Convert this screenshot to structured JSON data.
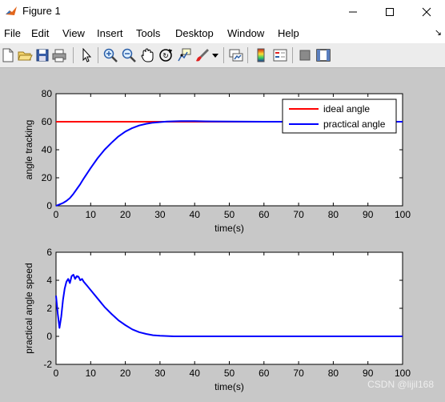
{
  "window": {
    "title": "Figure 1",
    "minimize_icon": "minimize-icon",
    "maximize_icon": "maximize-icon",
    "close_icon": "close-icon"
  },
  "menu": {
    "items": [
      "File",
      "Edit",
      "View",
      "Insert",
      "Tools",
      "Desktop",
      "Window",
      "Help"
    ],
    "overflow_arrow": "↘"
  },
  "toolbar": {
    "icons": [
      "new-figure-icon",
      "open-file-icon",
      "save-icon",
      "print-icon",
      "pointer-icon",
      "zoom-in-icon",
      "zoom-out-icon",
      "pan-icon",
      "rotate-3d-icon",
      "data-cursor-icon",
      "brush-icon",
      "link-plot-icon",
      "colorbar-icon",
      "legend-icon",
      "hide-plot-tools-icon",
      "show-plot-tools-icon"
    ]
  },
  "watermark": "CSDN @lijil168",
  "chart_data": [
    {
      "type": "line",
      "xlabel": "time(s)",
      "ylabel": "angle tracking",
      "xlim": [
        0,
        100
      ],
      "ylim": [
        0,
        80
      ],
      "xticks": [
        "0",
        "10",
        "20",
        "30",
        "40",
        "50",
        "60",
        "70",
        "80",
        "90",
        "100"
      ],
      "yticks": [
        "0",
        "20",
        "40",
        "60",
        "80"
      ],
      "legend": {
        "placement": "top-right"
      },
      "series": [
        {
          "name": "ideal angle",
          "color": "#ff0000",
          "x": [
            0,
            100
          ],
          "y": [
            60,
            60
          ]
        },
        {
          "name": "practical angle",
          "color": "#0000ff",
          "x": [
            0,
            1,
            2,
            3,
            4,
            5,
            6,
            7,
            8,
            10,
            12,
            14,
            16,
            18,
            20,
            22,
            24,
            26,
            28,
            30,
            32,
            34,
            36,
            38,
            40,
            45,
            50,
            60,
            70,
            80,
            90,
            100
          ],
          "y": [
            0,
            1,
            2,
            3.5,
            5.5,
            8.5,
            12,
            15.5,
            19.5,
            27,
            34,
            40,
            45,
            49.5,
            53,
            55.5,
            57.3,
            58.5,
            59.3,
            59.7,
            60.1,
            60.3,
            60.4,
            60.4,
            60.4,
            60.2,
            60.1,
            60,
            60,
            60,
            60,
            60
          ]
        }
      ]
    },
    {
      "type": "line",
      "xlabel": "time(s)",
      "ylabel": "practical angle speed",
      "xlim": [
        0,
        100
      ],
      "ylim": [
        -2,
        6
      ],
      "xticks": [
        "0",
        "10",
        "20",
        "30",
        "40",
        "50",
        "60",
        "70",
        "80",
        "90",
        "100"
      ],
      "yticks": [
        "-2",
        "0",
        "2",
        "4",
        "6"
      ],
      "series": [
        {
          "name": "practical angle speed",
          "color": "#0000ff",
          "x": [
            0,
            0.5,
            1,
            1.5,
            2,
            2.5,
            3,
            3.5,
            4,
            4.5,
            5,
            5.5,
            6,
            6.5,
            7,
            7.5,
            8,
            9,
            10,
            12,
            14,
            16,
            18,
            20,
            22,
            24,
            26,
            28,
            30,
            32,
            34,
            40,
            50,
            60,
            80,
            100
          ],
          "y": [
            2.9,
            1.6,
            0.6,
            1.4,
            2.6,
            3.4,
            3.9,
            4.1,
            3.8,
            4.3,
            4.4,
            4.1,
            4.3,
            4.25,
            4.0,
            4.1,
            3.9,
            3.6,
            3.3,
            2.7,
            2.1,
            1.6,
            1.15,
            0.8,
            0.5,
            0.3,
            0.17,
            0.08,
            0.04,
            0.02,
            0.0,
            0,
            0,
            0,
            0,
            0
          ]
        }
      ]
    }
  ]
}
